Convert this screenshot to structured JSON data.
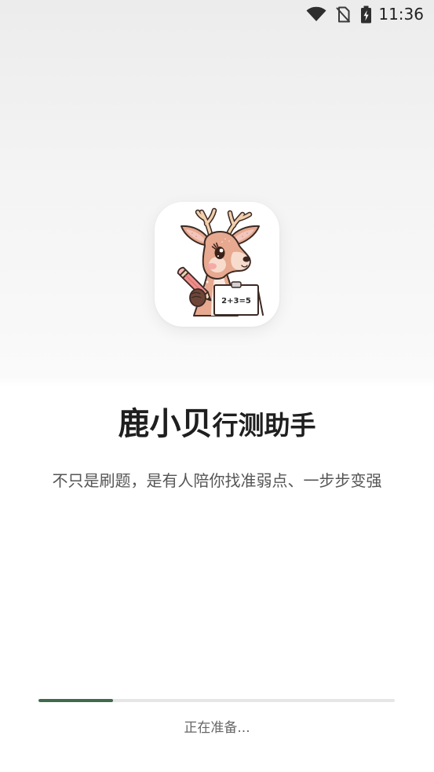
{
  "status_bar": {
    "time": "11:36",
    "icons": [
      "wifi-icon",
      "no-sim-icon",
      "battery-charging-icon"
    ]
  },
  "app": {
    "icon_name": "deer-mascot-logo",
    "logo_text": "2+3=5",
    "title_main": "鹿小贝",
    "title_sub": "行测助手",
    "tagline": "不只是刷题，是有人陪你找准弱点、一步步变强"
  },
  "loading": {
    "progress": 0.21,
    "label": "正在准备..."
  },
  "colors": {
    "accent": "#3d6b4c",
    "track": "#e6e6e6",
    "title": "#1f1f1f",
    "text": "#555555",
    "muted": "#666666"
  }
}
